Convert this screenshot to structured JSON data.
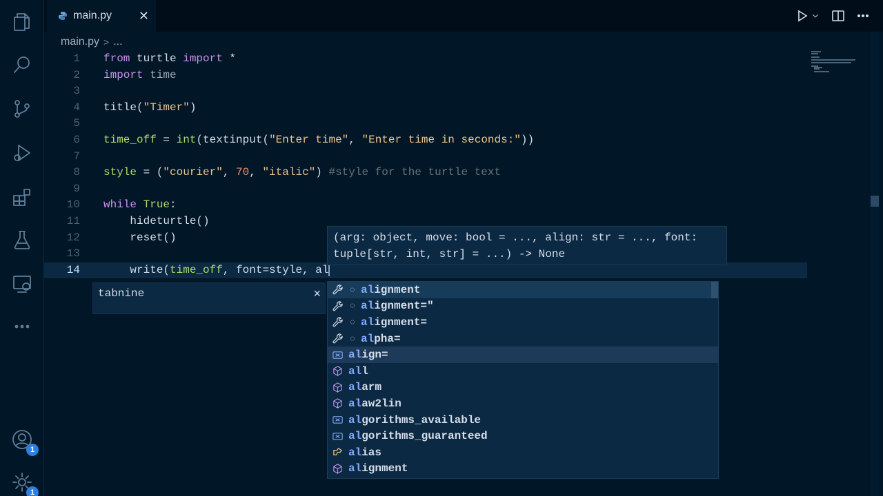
{
  "tabs": [
    {
      "label": "main.py",
      "language_icon": "python-icon"
    }
  ],
  "breadcrumb": {
    "file": "main.py",
    "separator": ">",
    "more": "..."
  },
  "editor": {
    "lines": [
      {
        "n": "1",
        "parts": [
          [
            "kw",
            "from"
          ],
          [
            "txt",
            " turtle "
          ],
          [
            "kw",
            "import"
          ],
          [
            "txt",
            " *"
          ]
        ]
      },
      {
        "n": "2",
        "parts": [
          [
            "kw",
            "import"
          ],
          [
            "dim",
            " time"
          ]
        ]
      },
      {
        "n": "3",
        "parts": []
      },
      {
        "n": "4",
        "parts": [
          [
            "txt",
            "title("
          ],
          [
            "str",
            "\"Timer\""
          ],
          [
            "txt",
            ")"
          ]
        ]
      },
      {
        "n": "5",
        "parts": []
      },
      {
        "n": "6",
        "parts": [
          [
            "mod",
            "time_off"
          ],
          [
            "txt",
            " = "
          ],
          [
            "mod",
            "int"
          ],
          [
            "txt",
            "(textinput("
          ],
          [
            "str",
            "\"Enter time\""
          ],
          [
            "txt",
            ", "
          ],
          [
            "str",
            "\"Enter time in seconds:\""
          ],
          [
            "txt",
            "))"
          ]
        ]
      },
      {
        "n": "7",
        "parts": []
      },
      {
        "n": "8",
        "parts": [
          [
            "mod",
            "style"
          ],
          [
            "txt",
            " = ("
          ],
          [
            "str",
            "\"courier\""
          ],
          [
            "txt",
            ", "
          ],
          [
            "num",
            "70"
          ],
          [
            "txt",
            ", "
          ],
          [
            "str",
            "\"italic\""
          ],
          [
            "txt",
            ") "
          ],
          [
            "cm",
            "#style for the turtle text"
          ]
        ]
      },
      {
        "n": "9",
        "parts": []
      },
      {
        "n": "10",
        "parts": [
          [
            "kw",
            "while"
          ],
          [
            "txt",
            " "
          ],
          [
            "mod",
            "True"
          ],
          [
            "txt",
            ":"
          ]
        ]
      },
      {
        "n": "11",
        "parts": [
          [
            "txt",
            "    hideturtle()"
          ]
        ]
      },
      {
        "n": "12",
        "parts": [
          [
            "txt",
            "    reset()"
          ]
        ]
      },
      {
        "n": "13",
        "parts": []
      },
      {
        "n": "14",
        "parts": [
          [
            "txt",
            "    write("
          ],
          [
            "mod",
            "time_off"
          ],
          [
            "txt",
            ", font=style, al"
          ]
        ],
        "current": true
      }
    ]
  },
  "signature_help": {
    "line1": "(arg: object, move: bool = ..., align: str = ..., font:",
    "line2": "tuple[str, int, str] = ...) -> None"
  },
  "tabnine": {
    "label": "tabnine",
    "close": "×"
  },
  "suggestions": [
    {
      "icon": "wrench-icon",
      "tabnine": true,
      "match": "al",
      "rest": "ignment",
      "state": "selected"
    },
    {
      "icon": "wrench-icon",
      "tabnine": true,
      "match": "al",
      "rest": "ignment=\""
    },
    {
      "icon": "wrench-icon",
      "tabnine": true,
      "match": "al",
      "rest": "ignment="
    },
    {
      "icon": "wrench-icon",
      "tabnine": true,
      "match": "al",
      "rest": "pha="
    },
    {
      "icon": "variable-icon",
      "tabnine": false,
      "match": "al",
      "rest": "ign=",
      "state": "hl"
    },
    {
      "icon": "module-icon",
      "tabnine": false,
      "match": "al",
      "rest": "l"
    },
    {
      "icon": "module-icon",
      "tabnine": false,
      "match": "al",
      "rest": "arm"
    },
    {
      "icon": "module-icon",
      "tabnine": false,
      "match": "al",
      "rest": "aw2lin"
    },
    {
      "icon": "variable-icon",
      "tabnine": false,
      "match": "al",
      "rest": "gorithms_available"
    },
    {
      "icon": "variable-icon",
      "tabnine": false,
      "match": "al",
      "rest": "gorithms_guaranteed"
    },
    {
      "icon": "class-icon",
      "tabnine": false,
      "match": "al",
      "rest": "ias"
    },
    {
      "icon": "module-icon",
      "tabnine": false,
      "match": "al",
      "rest": "ignment"
    }
  ],
  "activity_bar": {
    "items": [
      "explorer-icon",
      "search-icon",
      "source-control-icon",
      "run-debug-icon",
      "extensions-icon",
      "testing-icon",
      "remote-explorer-icon",
      "more-icon"
    ],
    "bottom": [
      {
        "icon": "account-icon",
        "badge": "1"
      },
      {
        "icon": "settings-gear-icon",
        "badge": "1"
      }
    ]
  },
  "colors": {
    "background": "#011627",
    "keyword": "#c792ea",
    "string": "#ecc48d",
    "number": "#f78c6c",
    "comment": "#637777",
    "match": "#82aaff",
    "badge": "#2f7fde"
  }
}
